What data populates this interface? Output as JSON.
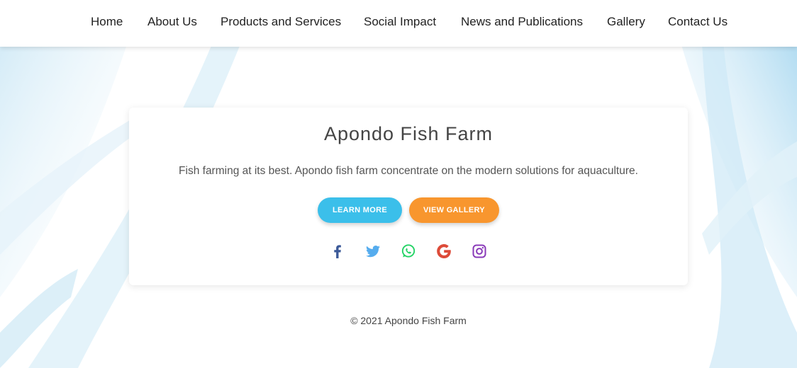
{
  "nav": {
    "items": [
      {
        "label": "Home"
      },
      {
        "label": "About Us"
      },
      {
        "label": "Products and Services"
      },
      {
        "label": "Social Impact"
      },
      {
        "label": "News and Publications"
      },
      {
        "label": "Gallery"
      },
      {
        "label": "Contact Us"
      }
    ]
  },
  "hero": {
    "title": "Apondo Fish Farm",
    "description": "Fish farming at its best. Apondo fish farm concentrate on the modern solutions for aquaculture.",
    "learn_more_label": "LEARN MORE",
    "view_gallery_label": "VIEW GALLERY"
  },
  "social": {
    "icons": [
      "facebook-icon",
      "twitter-icon",
      "whatsapp-icon",
      "google-icon",
      "instagram-icon"
    ]
  },
  "footer": {
    "copyright": "© 2021 Apondo Fish Farm"
  },
  "colors": {
    "learn_more": "#3bbfea",
    "view_gallery": "#f8962e",
    "facebook": "#3b5998",
    "twitter": "#55acee",
    "whatsapp": "#25d366",
    "google": "#dd4b39",
    "instagram": "#8a3ab9"
  }
}
